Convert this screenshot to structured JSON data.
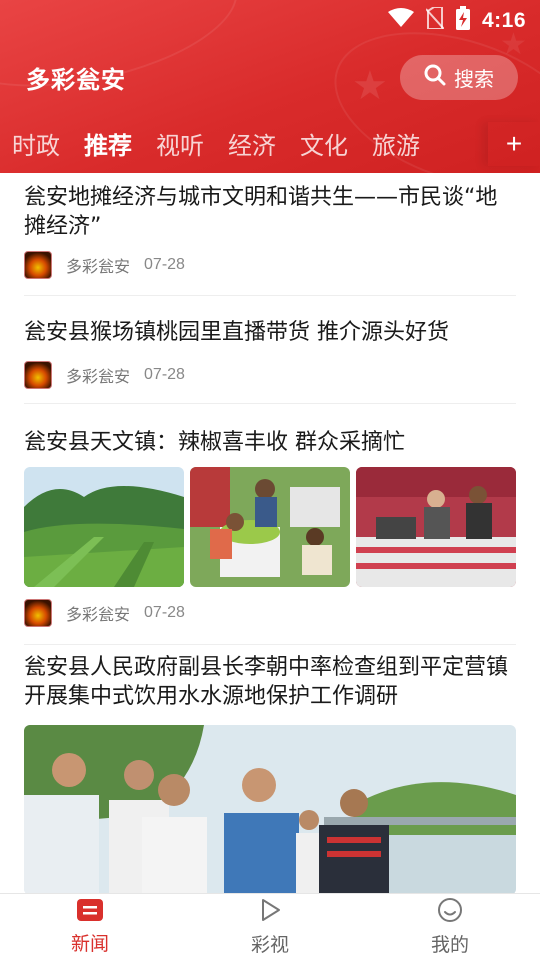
{
  "status_bar": {
    "time": "4:16"
  },
  "header": {
    "app_title": "多彩瓮安",
    "search_label": "搜索",
    "colors": {
      "primary": "#d92b2b",
      "accent_text": "#d9302c"
    }
  },
  "tabs": [
    {
      "label": "时政",
      "active": false
    },
    {
      "label": "推荐",
      "active": true
    },
    {
      "label": "视听",
      "active": false
    },
    {
      "label": "经济",
      "active": false
    },
    {
      "label": "文化",
      "active": false
    },
    {
      "label": "旅游",
      "active": false
    }
  ],
  "tab_add_label": "+",
  "articles": [
    {
      "title": "瓮安地摊经济与城市文明和谐共生——市民谈“地摊经济”",
      "source": "多彩瓮安",
      "date": "07-28"
    },
    {
      "title": "瓮安县猴场镇桃园里直播带货 推介源头好货",
      "source": "多彩瓮安",
      "date": "07-28"
    },
    {
      "title": "瓮安县天文镇：辣椒喜丰收 群众采摘忙",
      "source": "多彩瓮安",
      "date": "07-28"
    },
    {
      "title": "瓮安县人民政府副县长李朝中率检查组到平定营镇开展集中式饮用水水源地保护工作调研"
    }
  ],
  "bottom_nav": [
    {
      "label": "新闻",
      "icon": "news-icon",
      "active": true
    },
    {
      "label": "彩视",
      "icon": "play-icon",
      "active": false
    },
    {
      "label": "我的",
      "icon": "smile-icon",
      "active": false
    }
  ]
}
